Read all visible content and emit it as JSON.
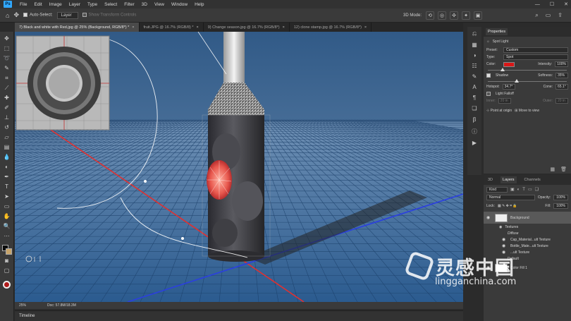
{
  "menu": [
    "File",
    "Edit",
    "Image",
    "Layer",
    "Type",
    "Select",
    "Filter",
    "3D",
    "View",
    "Window",
    "Help"
  ],
  "app_logo": "Ps",
  "window_controls": [
    "—",
    "☐",
    "✕"
  ],
  "options": {
    "auto_select": "Auto-Select:",
    "auto_select_value": "Layer",
    "show_transform": "Show Transform Controls",
    "mode_3d": "3D Mode:"
  },
  "tabs": [
    {
      "label": "7) Black and white with Red.jpg @ 25% (Background, RGB/8*) *",
      "active": true
    },
    {
      "label": "fruit.JPG @ 16.7% (RGB/8) *",
      "active": false
    },
    {
      "label": "9) Change season.jpg @ 16.7% (RGB/8*)",
      "active": false
    },
    {
      "label": "12) clone stamp.jpg @ 16.7% (RGB/8*)",
      "active": false
    }
  ],
  "status": {
    "zoom": "25%",
    "doc": "Doc: 57.8M/18.3M"
  },
  "timeline_label": "Timeline",
  "properties": {
    "tabs": [
      "Properties"
    ],
    "light_type_title": "Spot Light",
    "preset_label": "Preset:",
    "preset_value": "Custom",
    "type_label": "Type:",
    "type_value": "Spot",
    "color_label": "Color:",
    "color_value": "#d91717",
    "intensity_label": "Intensity:",
    "intensity_value": "100%",
    "shadow_label": "Shadow",
    "softness_label": "Softness:",
    "softness_value": "35%",
    "hotspot_label": "Hotspot:",
    "hotspot_value": "34.7°",
    "cone_label": "Cone:",
    "cone_value": "65.1°",
    "light_falloff": "Light Falloff",
    "inner_label": "Inner:",
    "inner_value": "20 in",
    "outer_label": "Outer:",
    "outer_value": "20 in",
    "point_at_origin": "Point at origin",
    "move_to_view": "Move to view"
  },
  "layers": {
    "tabs": [
      "3D",
      "Layers",
      "Channels"
    ],
    "kind_value": "Kind",
    "blend_mode": "Normal",
    "opacity_label": "Opacity:",
    "opacity_value": "100%",
    "lock_label": "Lock:",
    "fill_label": "Fill:",
    "fill_value": "100%",
    "background_name": "Background",
    "textures_label": "Textures",
    "diffuse_label": "Diffuse",
    "sub_items": [
      "Cap_Material...ult Texture",
      "Bottle_Mate...ult Texture",
      "...ult Texture"
    ],
    "default_label": "Default",
    "color_fill_label": "Color Fill 1"
  },
  "watermark": {
    "chinese": "灵感中国",
    "url": "lingganchina.com"
  }
}
